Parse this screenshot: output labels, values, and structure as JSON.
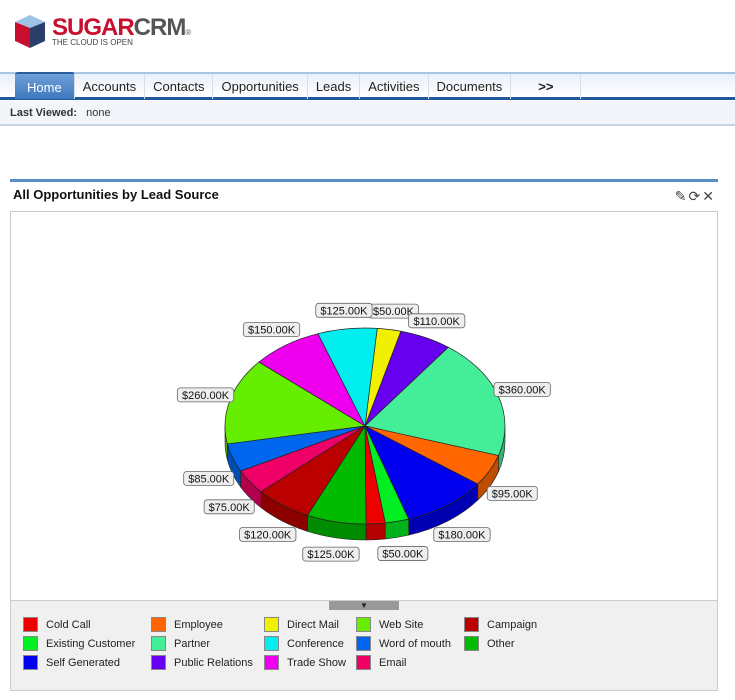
{
  "logo": {
    "name_part1": "SUGAR",
    "name_part2": "CRM",
    "reg": "®",
    "tagline": "THE CLOUD IS OPEN"
  },
  "nav": {
    "tabs": [
      "Home",
      "Accounts",
      "Contacts",
      "Opportunities",
      "Leads",
      "Activities",
      "Documents",
      ">>"
    ],
    "active": "Home"
  },
  "last_viewed": {
    "label": "Last Viewed:",
    "value": "none"
  },
  "dashlet": {
    "title": "All Opportunities by Lead Source",
    "icons": [
      "edit-icon",
      "refresh-icon",
      "close-icon"
    ]
  },
  "chart_data": {
    "type": "pie",
    "style": "3d",
    "title": "",
    "slices": [
      {
        "name": "Direct Mail",
        "value": 50,
        "label": "$50.00K",
        "color": "#f0f000"
      },
      {
        "name": "Public Relations",
        "value": 110,
        "label": "$110.00K",
        "color": "#6600ee"
      },
      {
        "name": "Partner",
        "value": 360,
        "label": "$360.00K",
        "color": "#44ee99"
      },
      {
        "name": "Employee",
        "value": 95,
        "label": "$95.00K",
        "color": "#ff6600"
      },
      {
        "name": "Self Generated",
        "value": 180,
        "label": "$180.00K",
        "color": "#0000ee"
      },
      {
        "name": "Existing Customer",
        "value": 50,
        "label": "$50.00K",
        "color": "#00ee22"
      },
      {
        "name": "Cold Call",
        "value": 40,
        "label": "",
        "color": "#ee0000"
      },
      {
        "name": "Other",
        "value": 125,
        "label": "$125.00K",
        "color": "#00bb00"
      },
      {
        "name": "Campaign",
        "value": 120,
        "label": "$120.00K",
        "color": "#bb0000"
      },
      {
        "name": "Email",
        "value": 75,
        "label": "$75.00K",
        "color": "#ee0066"
      },
      {
        "name": "Word of mouth",
        "value": 85,
        "label": "$85.00K",
        "color": "#0066ee"
      },
      {
        "name": "Web Site",
        "value": 260,
        "label": "$260.00K",
        "color": "#66ee00"
      },
      {
        "name": "Trade Show",
        "value": 150,
        "label": "$150.00K",
        "color": "#ee00ee"
      },
      {
        "name": "Conference",
        "value": 125,
        "label": "$125.00K",
        "color": "#00eeee"
      }
    ],
    "legend_placement": "bottom",
    "legend": [
      [
        "Cold Call",
        "#ee0000"
      ],
      [
        "Employee",
        "#ff6600"
      ],
      [
        "Direct Mail",
        "#f0f000"
      ],
      [
        "Web Site",
        "#66ee00"
      ],
      [
        "Campaign",
        "#bb0000"
      ],
      [
        "Existing Customer",
        "#00ee22"
      ],
      [
        "Partner",
        "#44ee99"
      ],
      [
        "Conference",
        "#00eeee"
      ],
      [
        "Word of mouth",
        "#0066ee"
      ],
      [
        "Other",
        "#00bb00"
      ],
      [
        "Self Generated",
        "#0000ee"
      ],
      [
        "Public Relations",
        "#6600ee"
      ],
      [
        "Trade Show",
        "#ee00ee"
      ],
      [
        "Email",
        "#ee0066"
      ]
    ]
  }
}
